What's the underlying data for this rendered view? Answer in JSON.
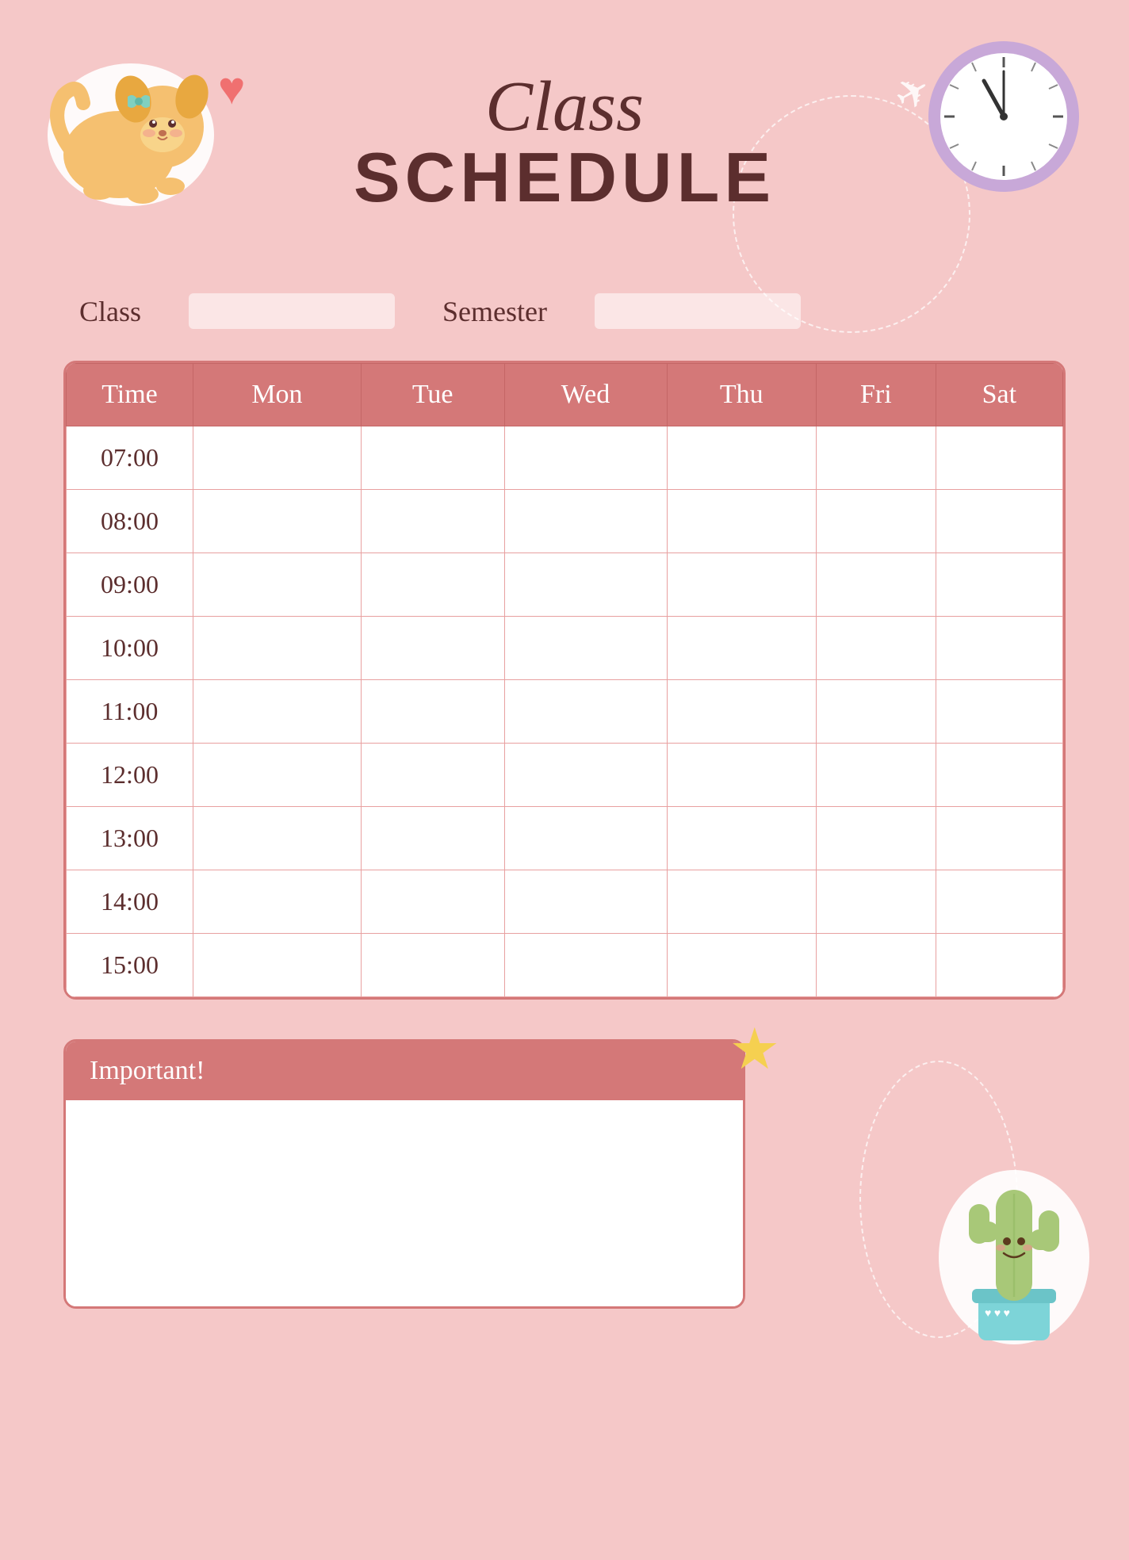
{
  "header": {
    "title_line1": "Class",
    "title_line2": "SCHEDULE"
  },
  "info": {
    "class_label": "Class",
    "semester_label": "Semester",
    "class_value": "",
    "semester_value": ""
  },
  "table": {
    "columns": [
      "Time",
      "Mon",
      "Tue",
      "Wed",
      "Thu",
      "Fri",
      "Sat"
    ],
    "rows": [
      {
        "time": "07:00",
        "cells": [
          "",
          "",
          "",
          "",
          "",
          ""
        ]
      },
      {
        "time": "08:00",
        "cells": [
          "",
          "",
          "",
          "",
          "",
          ""
        ]
      },
      {
        "time": "09:00",
        "cells": [
          "",
          "",
          "",
          "",
          "",
          ""
        ]
      },
      {
        "time": "10:00",
        "cells": [
          "",
          "",
          "",
          "",
          "",
          ""
        ]
      },
      {
        "time": "11:00",
        "cells": [
          "",
          "",
          "",
          "",
          "",
          ""
        ]
      },
      {
        "time": "12:00",
        "cells": [
          "",
          "",
          "",
          "",
          "",
          ""
        ]
      },
      {
        "time": "13:00",
        "cells": [
          "",
          "",
          "",
          "",
          "",
          ""
        ]
      },
      {
        "time": "14:00",
        "cells": [
          "",
          "",
          "",
          "",
          "",
          ""
        ]
      },
      {
        "time": "15:00",
        "cells": [
          "",
          "",
          "",
          "",
          "",
          ""
        ]
      }
    ]
  },
  "important": {
    "label": "Important!",
    "content": ""
  },
  "colors": {
    "bg": "#f5c8c8",
    "header_row": "#d47878",
    "border": "#d47878",
    "text_dark": "#5c2e2e",
    "white": "#ffffff"
  }
}
